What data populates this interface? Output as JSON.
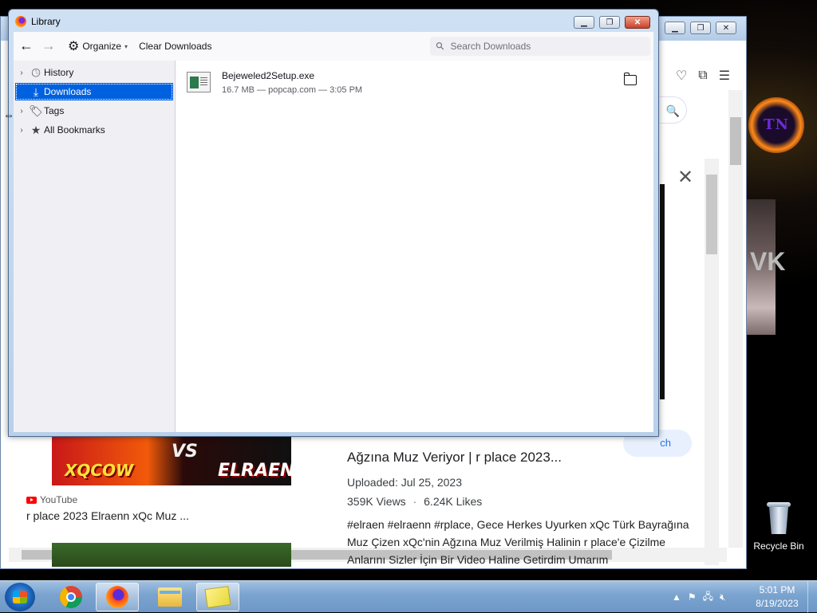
{
  "library": {
    "title": "Library",
    "toolbar": {
      "organize_label": "Organize",
      "clear_downloads_label": "Clear Downloads",
      "search_placeholder": "Search Downloads"
    },
    "sidebar": [
      {
        "label": "History",
        "icon": "clock-icon",
        "expandable": true
      },
      {
        "label": "Downloads",
        "icon": "download-icon",
        "selected": true
      },
      {
        "label": "Tags",
        "icon": "tag-icon",
        "expandable": true
      },
      {
        "label": "All Bookmarks",
        "icon": "star-icon",
        "expandable": true
      }
    ],
    "downloads": [
      {
        "name": "Bejeweled2Setup.exe",
        "meta": "16.7 MB — popcap.com — 3:05 PM"
      }
    ]
  },
  "browser": {
    "video_left": {
      "thumb_text_left": "XQCOW",
      "thumb_text_right": "ELRAENN",
      "thumb_text_mid": "VS",
      "source": "YouTube",
      "title": "r place 2023 Elraenn xQc Muz ..."
    },
    "detail": {
      "title": "Ağzına Muz Veriyor | r place 2023...",
      "uploaded": "Uploaded: Jul 25, 2023",
      "views": "359K Views",
      "likes": "6.24K Likes",
      "description": "#elraen #elraenn #rplace, Gece Herkes Uyurken xQc Türk Bayrağına Muz Çizen xQc'nin Ağzına Muz Verilmiş Halinin r place'e Çizilme Anlarını Sizler İçin Bir Video Haline Getirdim Umarım"
    },
    "search_pill_text": "ch",
    "scrollbar_thumb_range": [
      0.18,
      0.4
    ]
  },
  "desktop": {
    "recycle_bin_label": "Recycle Bin",
    "logo_text": "TN",
    "bg_text": "VK"
  },
  "taskbar": {
    "apps": [
      "Google Chrome",
      "Firefox",
      "File Explorer",
      "Sticky Notes"
    ],
    "active_app": "Firefox",
    "clock_time": "5:01 PM",
    "clock_date": "8/19/2023"
  },
  "colors": {
    "selection": "#0061e0",
    "youtube_red": "#ff0000",
    "link_blue": "#1a73e8"
  }
}
